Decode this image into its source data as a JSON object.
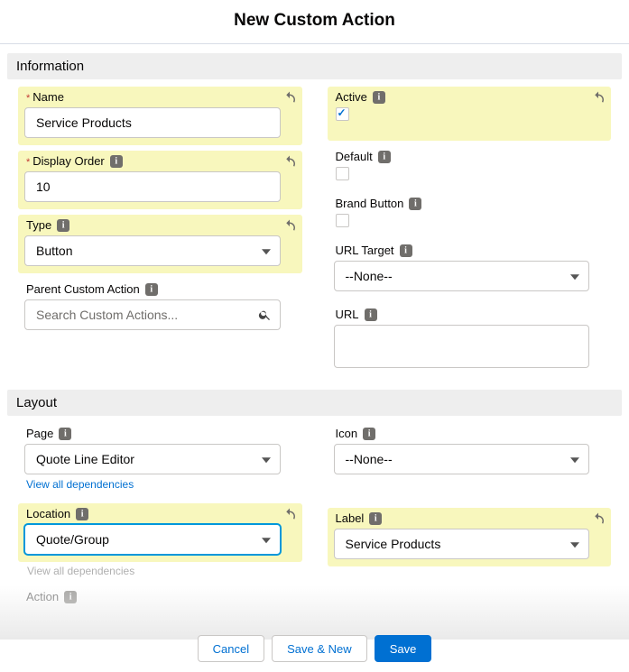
{
  "page_title": "New Custom Action",
  "sections": {
    "information": "Information",
    "layout": "Layout"
  },
  "fields": {
    "name": {
      "label": "Name",
      "value": "Service Products"
    },
    "display_order": {
      "label": "Display Order",
      "value": "10"
    },
    "type": {
      "label": "Type",
      "value": "Button"
    },
    "parent_custom_action": {
      "label": "Parent Custom Action",
      "placeholder": "Search Custom Actions..."
    },
    "active": {
      "label": "Active",
      "checked": true
    },
    "default": {
      "label": "Default",
      "checked": false
    },
    "brand_button": {
      "label": "Brand Button",
      "checked": false
    },
    "url_target": {
      "label": "URL Target",
      "value": "--None--"
    },
    "url": {
      "label": "URL",
      "value": ""
    },
    "page": {
      "label": "Page",
      "value": "Quote Line Editor"
    },
    "location": {
      "label": "Location",
      "value": "Quote/Group"
    },
    "action": {
      "label": "Action"
    },
    "icon": {
      "label": "Icon",
      "value": "--None--"
    },
    "label": {
      "label": "Label",
      "value": "Service Products"
    }
  },
  "links": {
    "view_deps": "View all dependencies"
  },
  "buttons": {
    "cancel": "Cancel",
    "save_new": "Save & New",
    "save": "Save"
  }
}
